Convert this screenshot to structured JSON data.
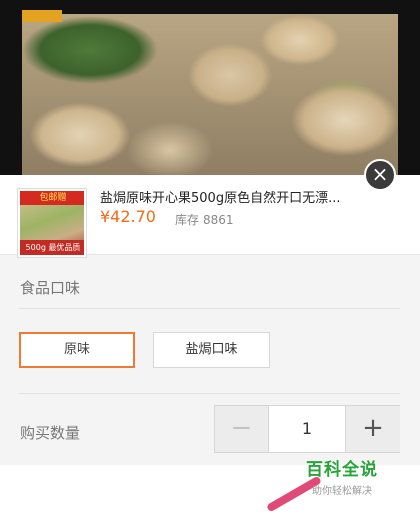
{
  "product": {
    "title": "盐焗原味开心果500g原色自然开口无漂...",
    "price": "¥42.70",
    "stock_label": "库存",
    "stock_value": "8861",
    "thumb_tag": "包邮赠",
    "thumb_weight": "500g 最优品质"
  },
  "close_icon": "×",
  "flavor": {
    "label": "食品口味",
    "options": [
      "原味",
      "盐焗口味"
    ],
    "selected_index": 0
  },
  "quantity": {
    "label": "购买数量",
    "minus": "−",
    "value": "1",
    "plus": "+"
  },
  "watermark": {
    "main": "百科全说",
    "sub": "助你轻松解决"
  },
  "colors": {
    "accent": "#f26a1b",
    "selected_border": "#f07a32",
    "watermark": "#26a43a"
  }
}
